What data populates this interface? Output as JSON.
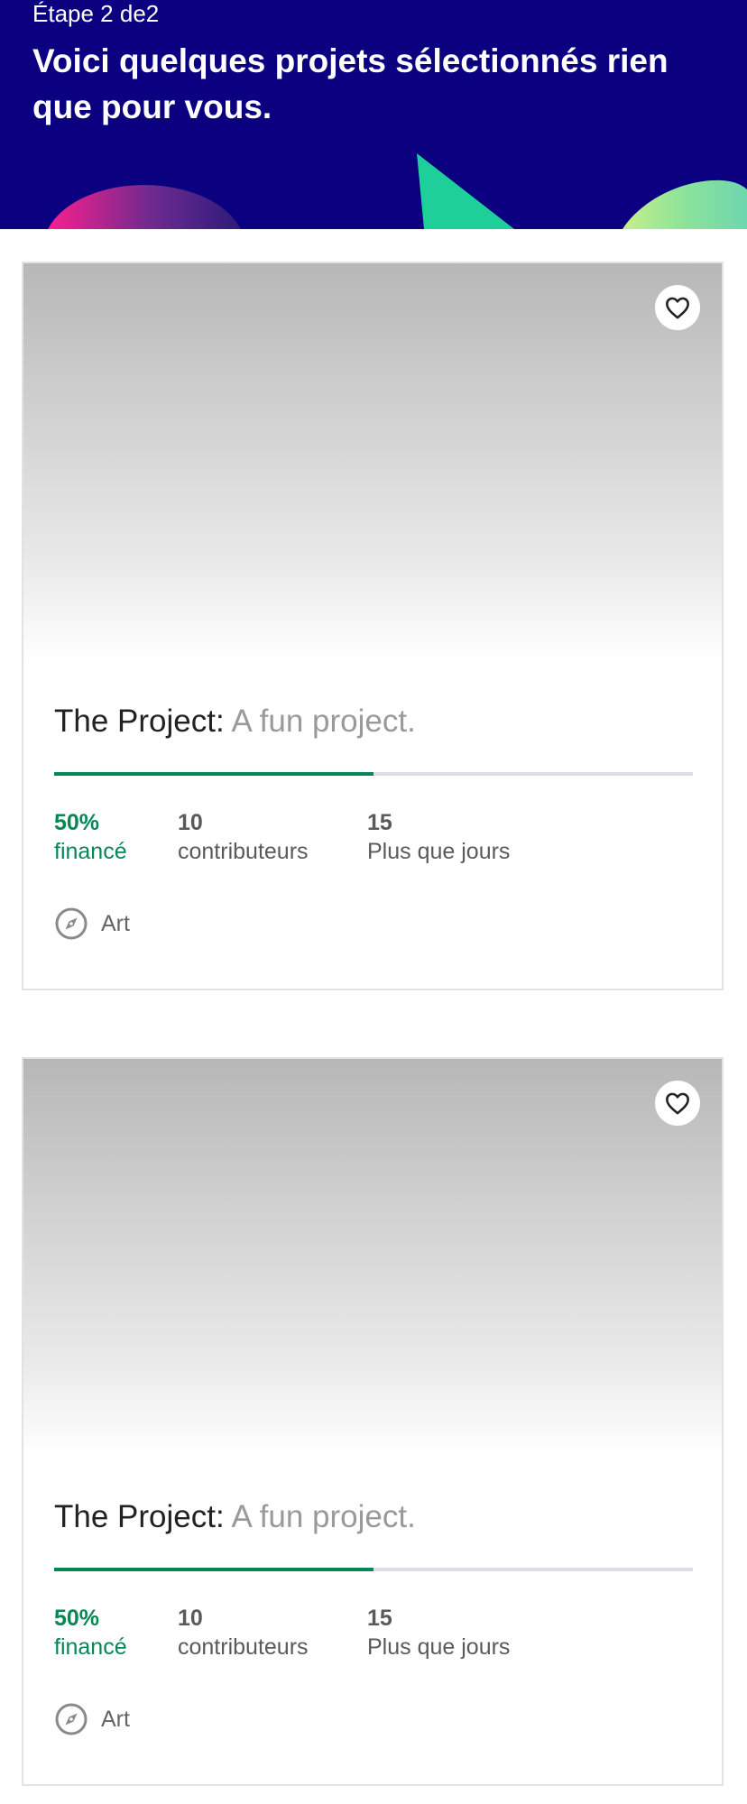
{
  "header": {
    "step_label": "Étape 2 de2",
    "title": "Voici quelques projets sélectionnés rien que pour vous."
  },
  "colors": {
    "header_bg": "#0a0080",
    "success_green": "#078753",
    "progress_track": "#dcdce6"
  },
  "projects": [
    {
      "name": "The Project:",
      "blurb": "A fun project.",
      "funded_percent": 50,
      "funded_value": "50%",
      "funded_label": "financé",
      "backers_value": "10",
      "backers_label": "contributeurs",
      "days_value": "15",
      "days_label": "Plus que jours",
      "category": "Art",
      "category_icon": "compass-icon",
      "favorite_icon": "heart-icon"
    },
    {
      "name": "The Project:",
      "blurb": "A fun project.",
      "funded_percent": 50,
      "funded_value": "50%",
      "funded_label": "financé",
      "backers_value": "10",
      "backers_label": "contributeurs",
      "days_value": "15",
      "days_label": "Plus que jours",
      "category": "Art",
      "category_icon": "compass-icon",
      "favorite_icon": "heart-icon"
    }
  ]
}
